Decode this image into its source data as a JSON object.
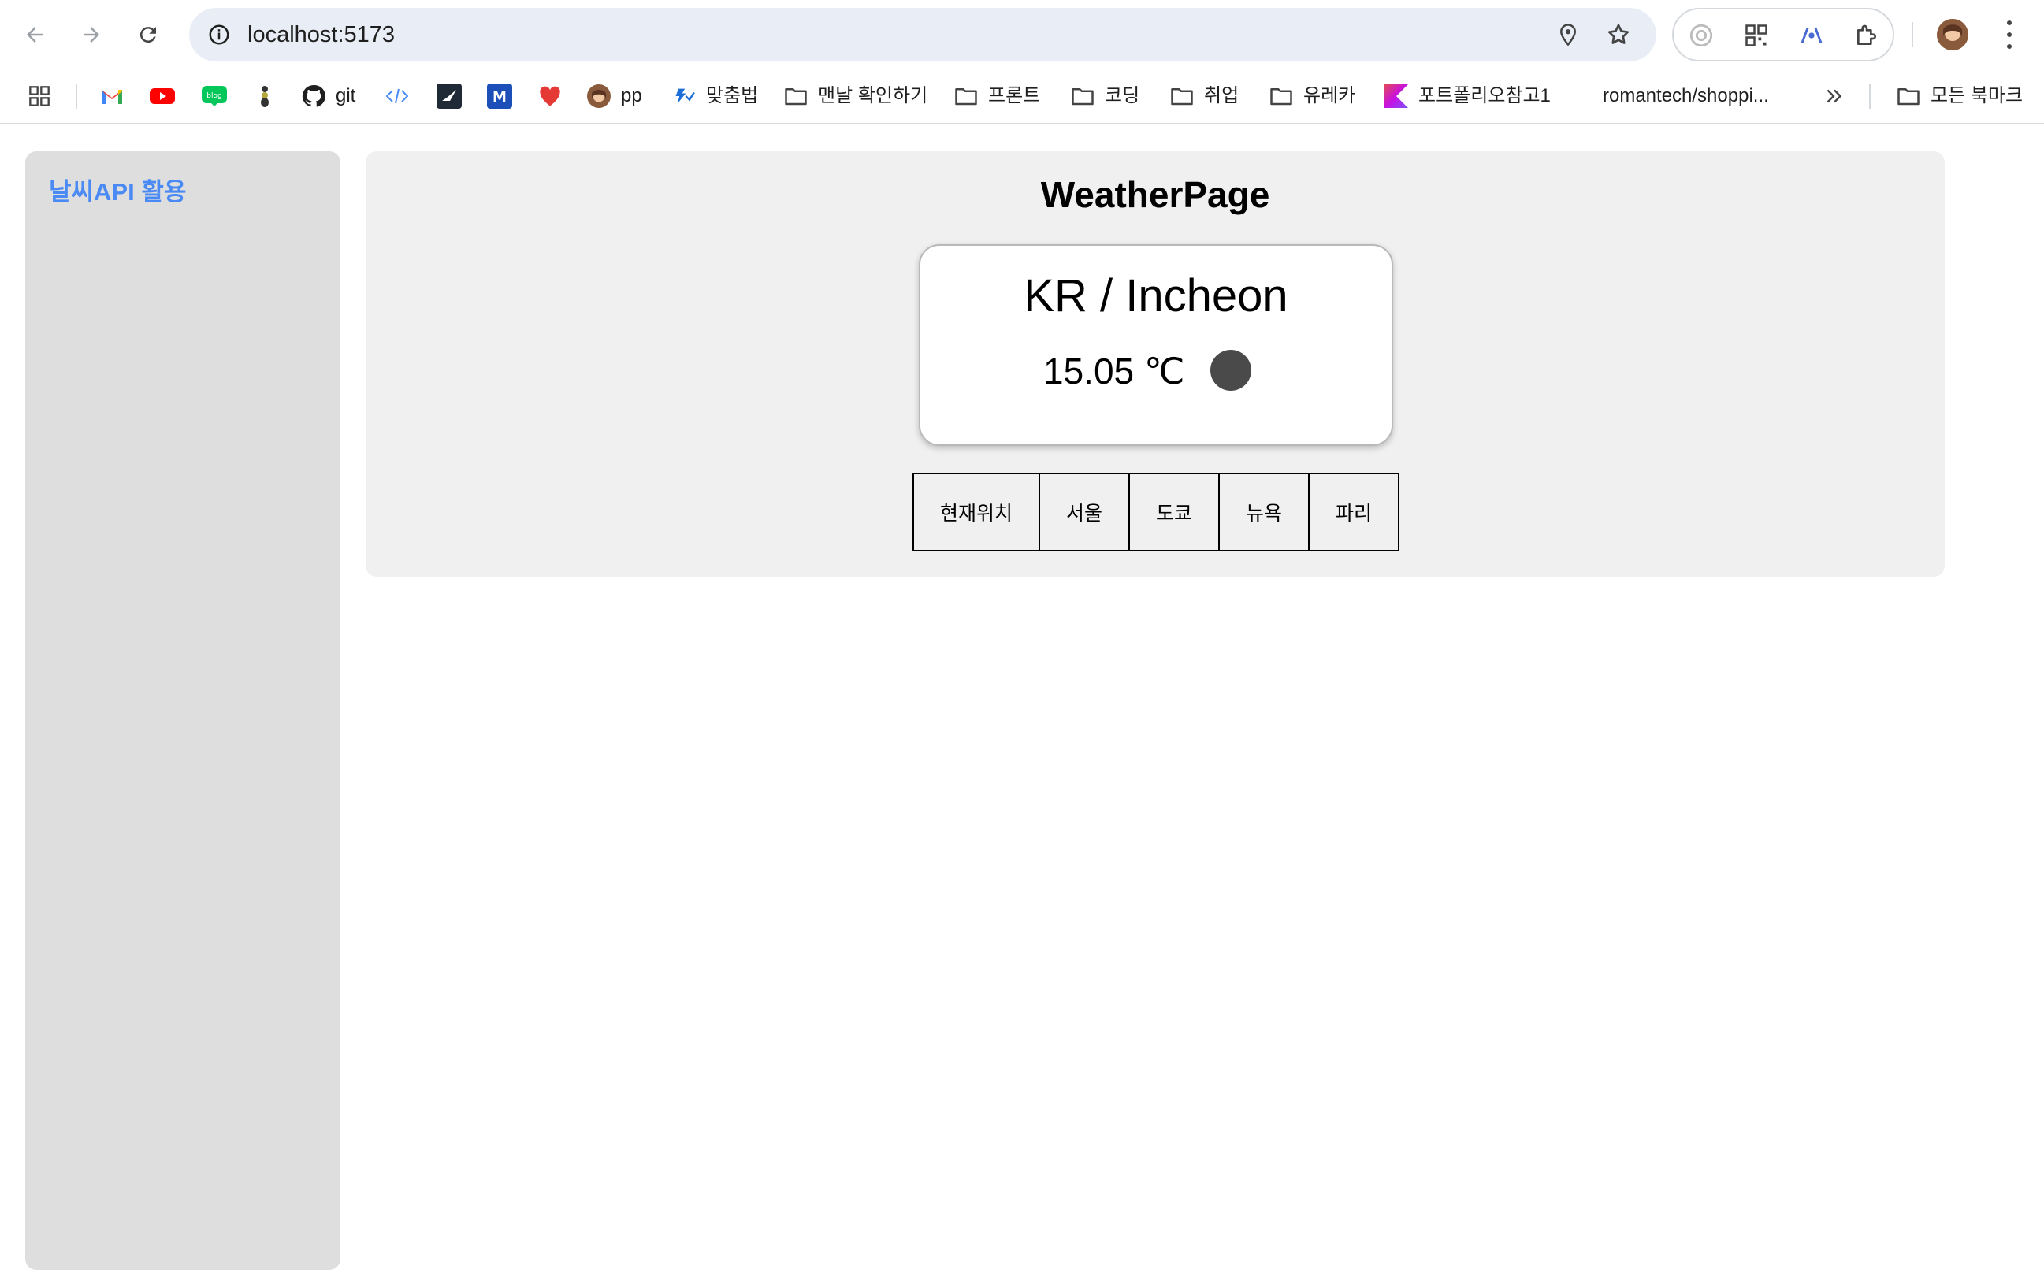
{
  "browser": {
    "url": "localhost:5173",
    "colors": {
      "omnibox_bg": "#e9eef6",
      "accent_link": "#4a8af4"
    },
    "bookmarks": [
      {
        "icon": "apps-grid-icon",
        "label": ""
      },
      {
        "icon": "gmail-icon",
        "label": ""
      },
      {
        "icon": "youtube-icon",
        "label": ""
      },
      {
        "icon": "blog-icon",
        "label": ""
      },
      {
        "icon": "ant-icon",
        "label": ""
      },
      {
        "icon": "github-icon",
        "label": "git"
      },
      {
        "icon": "code-brackets-icon",
        "label": ""
      },
      {
        "icon": "bird-icon",
        "label": ""
      },
      {
        "icon": "m-badge-icon",
        "label": ""
      },
      {
        "icon": "heart-icon",
        "label": ""
      },
      {
        "icon": "avatar-icon",
        "label": "pp"
      },
      {
        "icon": "spellcheck-icon",
        "label": "맞춤법"
      },
      {
        "icon": "folder-icon",
        "label": "맨날 확인하기"
      },
      {
        "icon": "folder-icon",
        "label": "프론트"
      },
      {
        "icon": "folder-icon",
        "label": "코딩"
      },
      {
        "icon": "folder-icon",
        "label": "취업"
      },
      {
        "icon": "folder-icon",
        "label": "유레카"
      },
      {
        "icon": "kotlin-icon",
        "label": "포트폴리오참고1"
      },
      {
        "icon": "",
        "label": "romantech/shoppi..."
      },
      {
        "icon": "chevron-double-right-icon",
        "label": ""
      },
      {
        "icon": "folder-icon",
        "label": "모든 북마크"
      }
    ]
  },
  "sidebar": {
    "title": "날씨API 활용"
  },
  "main": {
    "title": "WeatherPage",
    "card": {
      "location": "KR / Incheon",
      "temperature": "15.05 ℃",
      "weather_icon": "weather-icon-dark-circle"
    },
    "city_buttons": [
      "현재위치",
      "서울",
      "도쿄",
      "뉴욕",
      "파리"
    ]
  }
}
